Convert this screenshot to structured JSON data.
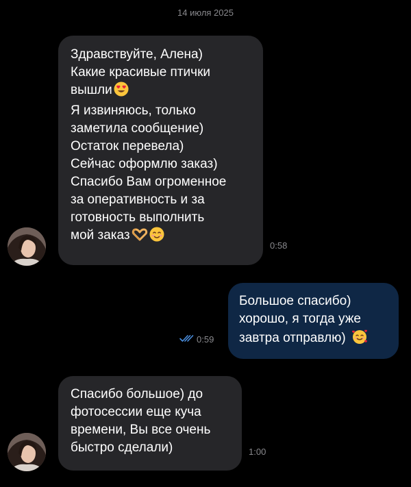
{
  "chat": {
    "date_separator": "14 июля 2025",
    "messages": [
      {
        "direction": "incoming",
        "lines": [
          "Здравствуйте, Алена)",
          "Какие красивые птички",
          "вышли",
          "Я извиняюсь, только",
          "заметила сообщение)",
          "Остаток перевела)",
          "Сейчас оформлю заказ)",
          "Спасибо Вам огроменное",
          "за оперативность и за",
          "готовность выполнить",
          "мой заказ"
        ],
        "emojis": [
          "heart-eyes-emoji",
          "heart-hands-emoji",
          "smiling-blush-emoji"
        ],
        "time": "0:58"
      },
      {
        "direction": "outgoing",
        "lines": [
          "Большое спасибо)",
          "хорошо, я тогда уже",
          "завтра отправлю)"
        ],
        "emojis": [
          "smiling-face-with-hearts-emoji"
        ],
        "time": "0:59",
        "status": "read",
        "status_icon": "double-check-icon"
      },
      {
        "direction": "incoming",
        "lines": [
          "Спасибо большое) до",
          "фотосессии еще куча",
          "времени, Вы все очень",
          "быстро сделали)"
        ],
        "emojis": [],
        "time": "1:00"
      }
    ]
  },
  "colors": {
    "background": "#000000",
    "incoming_bubble": "#262629",
    "outgoing_bubble": "#0f2745",
    "meta_text": "#8a8a8e",
    "read_check": "#4a8fe0"
  }
}
